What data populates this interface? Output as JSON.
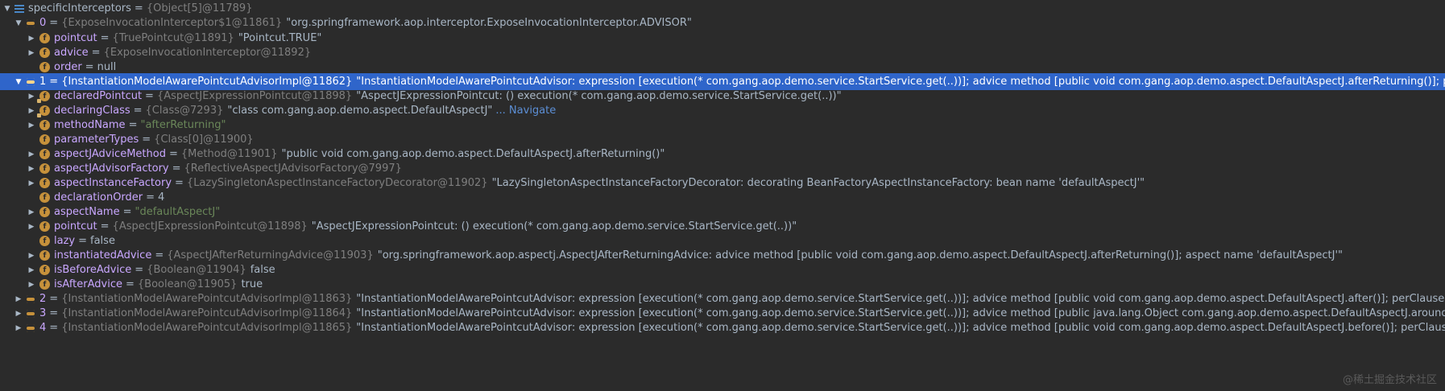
{
  "root": {
    "name": "specificInterceptors",
    "type": "{Object[5]@11789}"
  },
  "items": [
    {
      "name": "0",
      "type": "{ExposeInvocationInterceptor$1@11861}",
      "value": "\"org.springframework.aop.interceptor.ExposeInvocationInterceptor.ADVISOR\"",
      "expanded": true
    },
    {
      "name": "pointcut",
      "type": "{TruePointcut@11891}",
      "value": "\"Pointcut.TRUE\""
    },
    {
      "name": "advice",
      "type": "{ExposeInvocationInterceptor@11892}",
      "value": ""
    },
    {
      "name": "order",
      "type": "",
      "value": "null"
    },
    {
      "name": "1",
      "type": "{InstantiationModelAwarePointcutAdvisorImpl@11862}",
      "value": "\"InstantiationModelAwarePointcutAdvisor: expression [execution(* com.gang.aop.demo.service.StartService.get(..))]; advice method [public void com.gang.aop.demo.aspect.DefaultAspectJ.afterReturning()]; perClauseKind=SINGLETON\"",
      "expanded": true,
      "selected": true
    },
    {
      "name": "declaredPointcut",
      "type": "{AspectJExpressionPointcut@11898}",
      "value": "\"AspectJExpressionPointcut: () execution(* com.gang.aop.demo.service.StartService.get(..))\""
    },
    {
      "name": "declaringClass",
      "type": "{Class@7293}",
      "value": "\"class com.gang.aop.demo.aspect.DefaultAspectJ\"",
      "link": "... Navigate"
    },
    {
      "name": "methodName",
      "type": "",
      "value": "\"afterReturning\""
    },
    {
      "name": "parameterTypes",
      "type": "{Class[0]@11900}",
      "value": ""
    },
    {
      "name": "aspectJAdviceMethod",
      "type": "{Method@11901}",
      "value": "\"public void com.gang.aop.demo.aspect.DefaultAspectJ.afterReturning()\""
    },
    {
      "name": "aspectJAdvisorFactory",
      "type": "{ReflectiveAspectJAdvisorFactory@7997}",
      "value": ""
    },
    {
      "name": "aspectInstanceFactory",
      "type": "{LazySingletonAspectInstanceFactoryDecorator@11902}",
      "value": "\"LazySingletonAspectInstanceFactoryDecorator: decorating BeanFactoryAspectInstanceFactory: bean name 'defaultAspectJ'\""
    },
    {
      "name": "declarationOrder",
      "type": "",
      "value": "4"
    },
    {
      "name": "aspectName",
      "type": "",
      "value": "\"defaultAspectJ\""
    },
    {
      "name": "pointcut",
      "type": "{AspectJExpressionPointcut@11898}",
      "value": "\"AspectJExpressionPointcut: () execution(* com.gang.aop.demo.service.StartService.get(..))\""
    },
    {
      "name": "lazy",
      "type": "",
      "value": "false"
    },
    {
      "name": "instantiatedAdvice",
      "type": "{AspectJAfterReturningAdvice@11903}",
      "value": "\"org.springframework.aop.aspectj.AspectJAfterReturningAdvice: advice method [public void com.gang.aop.demo.aspect.DefaultAspectJ.afterReturning()]; aspect name 'defaultAspectJ'\""
    },
    {
      "name": "isBeforeAdvice",
      "type": "{Boolean@11904}",
      "value": "false"
    },
    {
      "name": "isAfterAdvice",
      "type": "{Boolean@11905}",
      "value": "true"
    },
    {
      "name": "2",
      "type": "{InstantiationModelAwarePointcutAdvisorImpl@11863}",
      "value": "\"InstantiationModelAwarePointcutAdvisor: expression [execution(* com.gang.aop.demo.service.StartService.get(..))]; advice method [public void com.gang.aop.demo.aspect.DefaultAspectJ.after()]; perClauseKind=SINGLETON\""
    },
    {
      "name": "3",
      "type": "{InstantiationModelAwarePointcutAdvisorImpl@11864}",
      "value": "\"InstantiationModelAwarePointcutAdvisor: expression [execution(* com.gang.aop.demo.service.StartService.get(..))]; advice method [public java.lang.Object com.gang.aop.demo.aspect.DefaultAspectJ.around(org.aspectj.lang.ProceedingJoi..."
    },
    {
      "name": "4",
      "type": "{InstantiationModelAwarePointcutAdvisorImpl@11865}",
      "value": "\"InstantiationModelAwarePointcutAdvisor: expression [execution(* com.gang.aop.demo.service.StartService.get(..))]; advice method [public void com.gang.aop.demo.aspect.DefaultAspectJ.before()]; perClauseKind=SINGLETON"
    }
  ],
  "watermark": "@稀土掘金技术社区",
  "colors": {
    "background": "#2b2b2b",
    "selection": "#2f65ca",
    "field_icon": "#c6913b",
    "string": "#6a8759",
    "type": "#7f7f7f"
  }
}
